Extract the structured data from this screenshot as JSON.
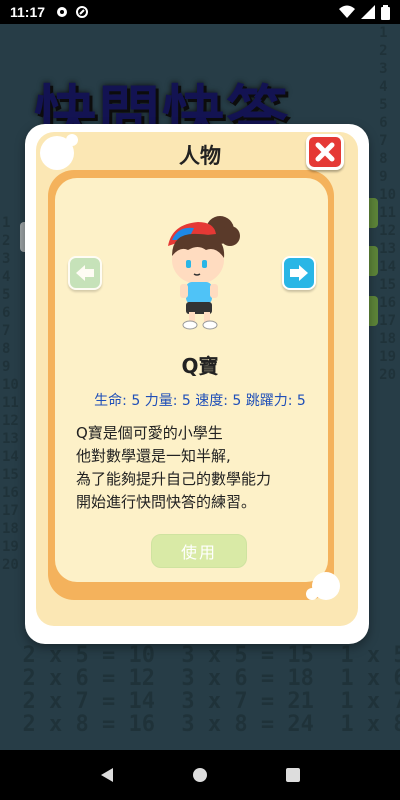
{
  "status": {
    "time": "11:17"
  },
  "background": {
    "title": "快問快答",
    "table_left": "  2 x 5 = 10  3 x 5 = 15  1 x 5 = 5\n  2 x 6 = 12  3 x 6 = 18  1 x 6 = 6\n  2 x 7 = 14  3 x 7 = 21  1 x 7 = 7\n  2 x 8 = 16  3 x 8 = 24  1 x 8 = 8",
    "table_side": "1\n2\n3\n4\n5\n6\n7\n8\n9\n10\n11\n12\n13\n14\n15\n16\n17\n18\n19\n20"
  },
  "dialog": {
    "title": "人物",
    "character_name": "Q寶",
    "stats": "生命: 5 力量: 5 速度: 5 跳躍力: 5",
    "description": [
      "Q寶是個可愛的小學生",
      "他對數學還是一知半解,",
      "為了能夠提升自己的數學能力",
      "開始進行快問快答的練習。"
    ],
    "use_label": "使用"
  },
  "colors": {
    "accent": "#29b6e6",
    "close": "#e53935",
    "stats_text": "#1f4fb8"
  },
  "icons": [
    "close-icon",
    "arrow-left-icon",
    "arrow-right-icon",
    "back-icon",
    "home-icon",
    "recents-icon"
  ]
}
